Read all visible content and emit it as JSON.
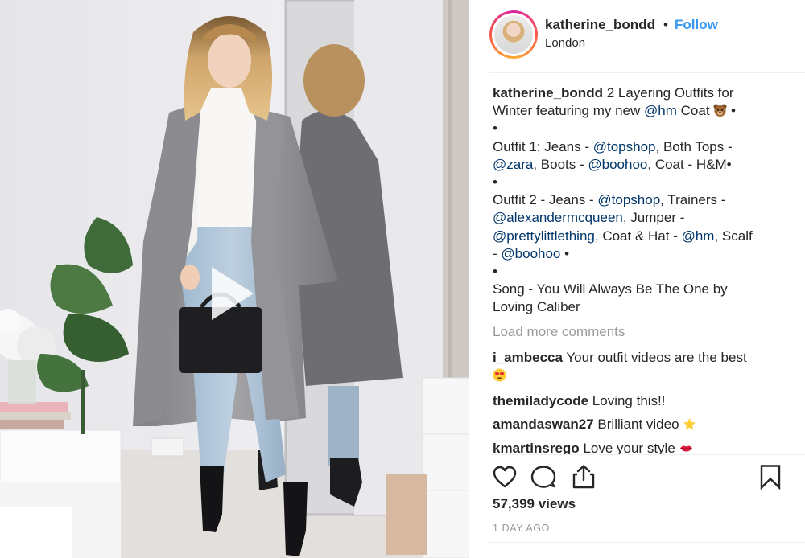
{
  "header": {
    "username": "katherine_bondd",
    "separator": "•",
    "follow_label": "Follow",
    "location": "London"
  },
  "caption": {
    "username": "katherine_bondd",
    "lines": [
      "2 Layering Outfits for",
      "Winter featuring my new",
      "@hm",
      "Coat",
      "•",
      "•",
      "Outfit 1: Jeans -",
      "@topshop",
      ", Both Tops -",
      "@zara",
      ", Boots -",
      "@boohoo",
      ", Coat - H&M•",
      "•",
      "Outfit 2 - Jeans -",
      "@topshop",
      ", Trainers -",
      "@alexandermcqueen",
      ", Jumper -",
      "@prettylittlething",
      ", Coat & Hat -",
      "@hm",
      ", Scalf",
      "-",
      "@boohoo",
      "•",
      "•",
      "Song - You Will Always Be The One by",
      "Loving Caliber"
    ]
  },
  "load_more": "Load more comments",
  "comments": [
    {
      "username": "i_ambecca",
      "text": "Your outfit videos are the best",
      "emoji": "heart-eyes-emoji"
    },
    {
      "username": "themiladycode",
      "text": "Loving this!!"
    },
    {
      "username": "amandaswan27",
      "text": "Brilliant video",
      "emoji": "star-emoji"
    },
    {
      "username": "kmartinsrego",
      "text": "Love your style",
      "emoji": "lips-emoji"
    }
  ],
  "actions": {
    "like_icon": "heart-icon",
    "comment_icon": "comment-bubble-icon",
    "share_icon": "share-icon",
    "save_icon": "bookmark-icon"
  },
  "views": "57,399 views",
  "posted": "1 DAY AGO",
  "media": {
    "play_icon": "play-icon"
  },
  "colors": {
    "link": "#3897f0",
    "mention": "#003569",
    "muted": "#999999",
    "text": "#262626"
  }
}
